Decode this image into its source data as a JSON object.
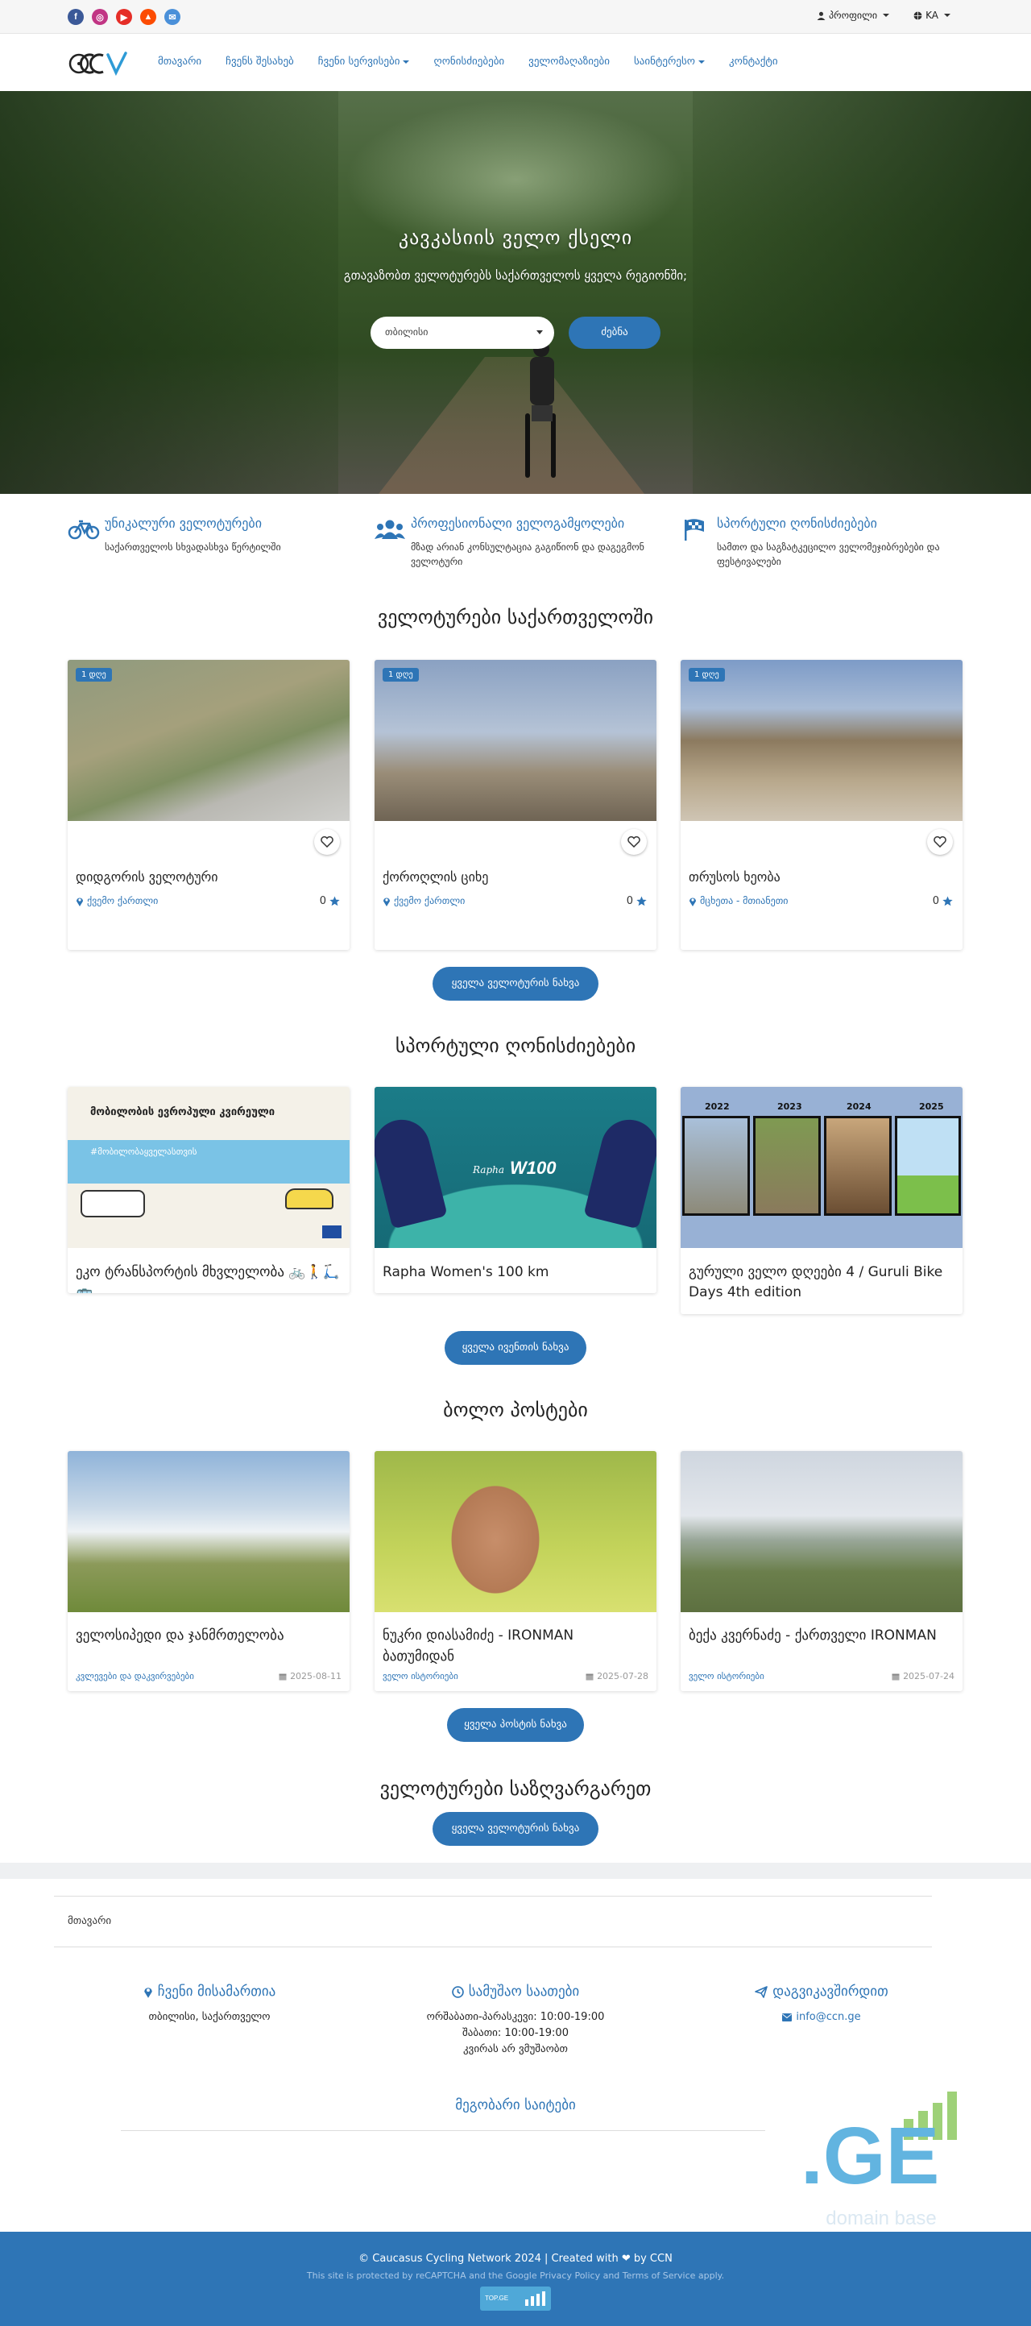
{
  "topbar": {
    "social": [
      "facebook-icon",
      "instagram-icon",
      "youtube-icon",
      "strava-icon",
      "email-icon"
    ],
    "profile_label": "პროფილი",
    "language_label": "KA"
  },
  "nav": {
    "items": [
      {
        "label": "მთავარი"
      },
      {
        "label": "ჩვენს შესახებ"
      },
      {
        "label": "ჩვენი სერვისები"
      },
      {
        "label": "ღონისძიებები"
      },
      {
        "label": "ველომაღაზიები"
      },
      {
        "label": "საინტერესო"
      },
      {
        "label": "კონტაქტი"
      }
    ]
  },
  "hero": {
    "title": "კავკასიის ველო ქსელი",
    "subtitle": "გთავაზობთ ველოტურებს საქართველოს ყველა რეგიონში;",
    "select_value": "თბილისი",
    "search_label": "ძებნა"
  },
  "features": [
    {
      "title": "უნიკალური ველოტურები",
      "desc": "საქართველოს სხვადასხვა წერტილში",
      "icon": "bicycle-icon"
    },
    {
      "title": "პროფესიონალი ველოგამყოლები",
      "desc": "მზად არიან კონსულტაცია გაგიწიონ და დაგეგმონ ველოტური",
      "icon": "users-icon"
    },
    {
      "title": "სპორტული ღონისძიებები",
      "desc": "სამთო და საგზატკეცილო ველომეჯიბრებები და ფესტივალები",
      "icon": "checkered-flag-icon"
    }
  ],
  "tours": {
    "title": "ველოტურები საქართველოში",
    "items": [
      {
        "badge": "1 დღე",
        "name": "დიდგორის ველოტური",
        "location": "ქვემო ქართლი",
        "rating": "0"
      },
      {
        "badge": "1 დღე",
        "name": "ქოროღლის ციხე",
        "location": "ქვემო ქართლი",
        "rating": "0"
      },
      {
        "badge": "1 დღე",
        "name": "თრუსოს ხეობა",
        "location": "მცხეთა - მთიანეთი",
        "rating": "0"
      }
    ],
    "button": "ყველა ველოტურის ნახვა"
  },
  "events": {
    "title": "სპორტული ღონისძიებები",
    "items": [
      {
        "title": "ეკო ტრანსპორტის მხვლელობა 🚲🚶🛴🚌",
        "poster_heading": "მობილობის ევროპული კვირეული",
        "poster_tag": "#მობილობაყველასთვის"
      },
      {
        "title": "Rapha Women's 100 km",
        "poster_brand": "Rapha",
        "poster_mark": "W100"
      },
      {
        "title": "გურული ველო დღეები 4 / Guruli Bike Days 4th edition",
        "poster_years": [
          "2022",
          "2023",
          "2024",
          "2025"
        ]
      }
    ],
    "button": "ყველა ივენთის ნახვა"
  },
  "posts": {
    "title": "ბოლო პოსტები",
    "items": [
      {
        "title": "ველოსიპედი და ჯანმრთელობა",
        "category": "კვლევები და დაკვირვებები",
        "date": "2025-08-11"
      },
      {
        "title": "ნუკრი დიასამიძე - IRONMAN ბათუმიდან",
        "category": "ველო ისტორიები",
        "date": "2025-07-28"
      },
      {
        "title": "ბექა კვერნაძე - ქართველი IRONMAN",
        "category": "ველო ისტორიები",
        "date": "2025-07-24"
      }
    ],
    "button": "ყველა პოსტის ნახვა"
  },
  "abroad": {
    "title": "ველოტურები საზღვარგარეთ",
    "button": "ყველა ველოტურის ნახვა"
  },
  "footer": {
    "breadcrumb": "მთავარი",
    "address_title": "ჩვენი მისამართია",
    "address": "თბილისი, საქართველო",
    "hours_title": "სამუშაო საათები",
    "hours": [
      "ორშაბათი-პარასკევი: 10:00-19:00",
      "შაბათი: 10:00-19:00",
      "კვირას არ ვმუშაობთ"
    ],
    "contact_title": "დაგვიკავშირდით",
    "email": "info@ccn.ge",
    "friends_title": "მეგობარი საიტები",
    "ge_logo": ".GE",
    "ge_logo_sub": "domain base",
    "copyright": "© Caucasus Cycling Network 2024 | Created with ❤ by CCN",
    "recaptcha": "This site is protected by reCAPTCHA and the Google Privacy Policy and Terms of Service apply.",
    "counter": "TOP.GE"
  },
  "colors": {
    "accent": "#2e75b6",
    "footer_bg": "#2e75b6"
  }
}
